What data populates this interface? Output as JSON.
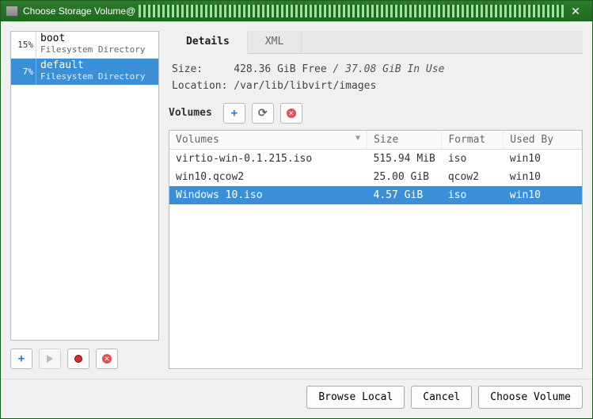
{
  "window": {
    "title": "Choose Storage Volume@"
  },
  "pools": [
    {
      "pct": "15%",
      "name": "boot",
      "subtype": "Filesystem Directory",
      "selected": false
    },
    {
      "pct": "7%",
      "name": "default",
      "subtype": "Filesystem Directory",
      "selected": true
    }
  ],
  "tabs": {
    "details": "Details",
    "xml": "XML"
  },
  "info": {
    "size_label": "Size:",
    "free": "428.36 GiB Free",
    "sep": " / ",
    "in_use": "37.08 GiB In Use",
    "location_label": "Location:",
    "location_value": "/var/lib/libvirt/images"
  },
  "vol_toolbar": {
    "label": "Volumes"
  },
  "vol_headers": {
    "name": "Volumes",
    "size": "Size",
    "format": "Format",
    "usedby": "Used By"
  },
  "volumes": [
    {
      "name": "virtio-win-0.1.215.iso",
      "size": "515.94 MiB",
      "format": "iso",
      "usedby": "win10",
      "selected": false
    },
    {
      "name": "win10.qcow2",
      "size": "25.00 GiB",
      "format": "qcow2",
      "usedby": "win10",
      "selected": false
    },
    {
      "name": "Windows 10.iso",
      "size": "4.57 GiB",
      "format": "iso",
      "usedby": "win10",
      "selected": true
    }
  ],
  "footer": {
    "browse_local": "Browse Local",
    "cancel": "Cancel",
    "choose_volume": "Choose Volume"
  }
}
